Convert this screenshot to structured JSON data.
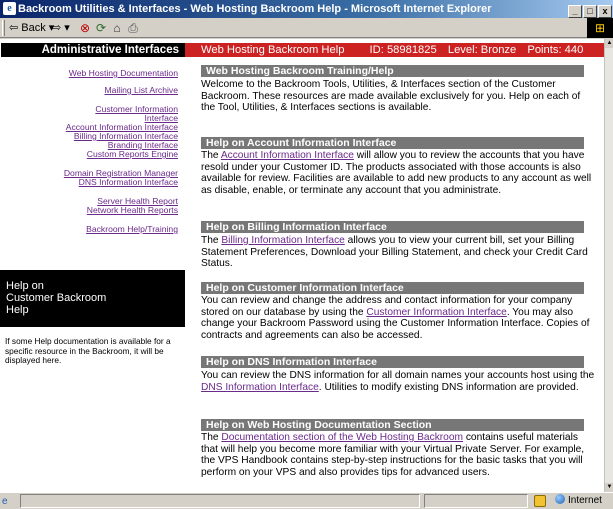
{
  "window": {
    "title": "Backroom Utilities & Interfaces - Web Hosting Backroom Help - Microsoft Internet Explorer",
    "min_label": "_",
    "max_label": "□",
    "close_label": "x"
  },
  "toolbar": {
    "back_label": "⇦ Back ▾",
    "forward_label": "⇨ ▾"
  },
  "sidebar": {
    "header": "Administrative Interfaces",
    "links": [
      "Web Hosting Documentation",
      "Mailing List Archive",
      "Customer Information",
      "Interface",
      "Account Information Interface",
      "Billing Information Interface",
      "Branding Interface",
      "Custom Reports Engine",
      "Domain Registration Manager",
      "DNS Information Interface",
      "Server Health Report",
      "Network Health Reports",
      "Backroom Help/Training"
    ],
    "help_box": [
      "Help on",
      "Customer Backroom",
      "Help"
    ],
    "help_note": "If some Help documentation is available for a specific resource in the Backroom, it will be displayed here."
  },
  "topbar": {
    "title": "Web Hosting Backroom Help",
    "id_label": "ID: 58981825",
    "level_label": "Level: Bronze",
    "points_label": "Points: 440"
  },
  "sections": [
    {
      "heading": "Web Hosting Backroom Training/Help",
      "before": "Welcome to the Backroom Tools, Utilities, & Interfaces section of the Customer Backroom. These resources are made available exclusively for you. Help on each of the Tool, Utilities, & Interfaces sections is available.",
      "link": "",
      "after": ""
    },
    {
      "heading": "Help on Account Information Interface",
      "before": "The ",
      "link": "Account Information Interface",
      "after": " will allow you to review the accounts that you have resold under your Customer ID. The products associated with those accounts is also available for review. Facilities are available to add new products to any account as well as disable, enable, or terminate any account that you administrate."
    },
    {
      "heading": "Help on Billing Information Interface",
      "before": "The ",
      "link": "Billing Information Interface",
      "after": " allows you to view your current bill, set your Billing Statement Preferences, Download your Billing Statement, and check your Credit Card Status."
    },
    {
      "heading": "Help on Customer Information Interface",
      "before": "You can review and change the address and contact information for your company stored on our database by using the ",
      "link": "Customer Information Interface",
      "after": ". You may also change your Backroom Password using the Customer Information Interface. Copies of contracts and agreements can also be accessed."
    },
    {
      "heading": "Help on DNS Information Interface",
      "before": "You can review the DNS information for all domain names your accounts host using the ",
      "link": "DNS Information Interface",
      "after": ". Utilities to modify existing DNS information are provided."
    },
    {
      "heading": "Help on Web Hosting Documentation Section",
      "before": "The ",
      "link": "Documentation section of the Web Hosting Backroom",
      "after": " contains useful materials that will help you become more familiar with your Virtual Private Server. For example, the VPS Handbook contains step-by-step instructions for the basic tasks that you will perform on your VPS and also provides tips for advanced users."
    }
  ],
  "status": {
    "zone": "Internet"
  }
}
